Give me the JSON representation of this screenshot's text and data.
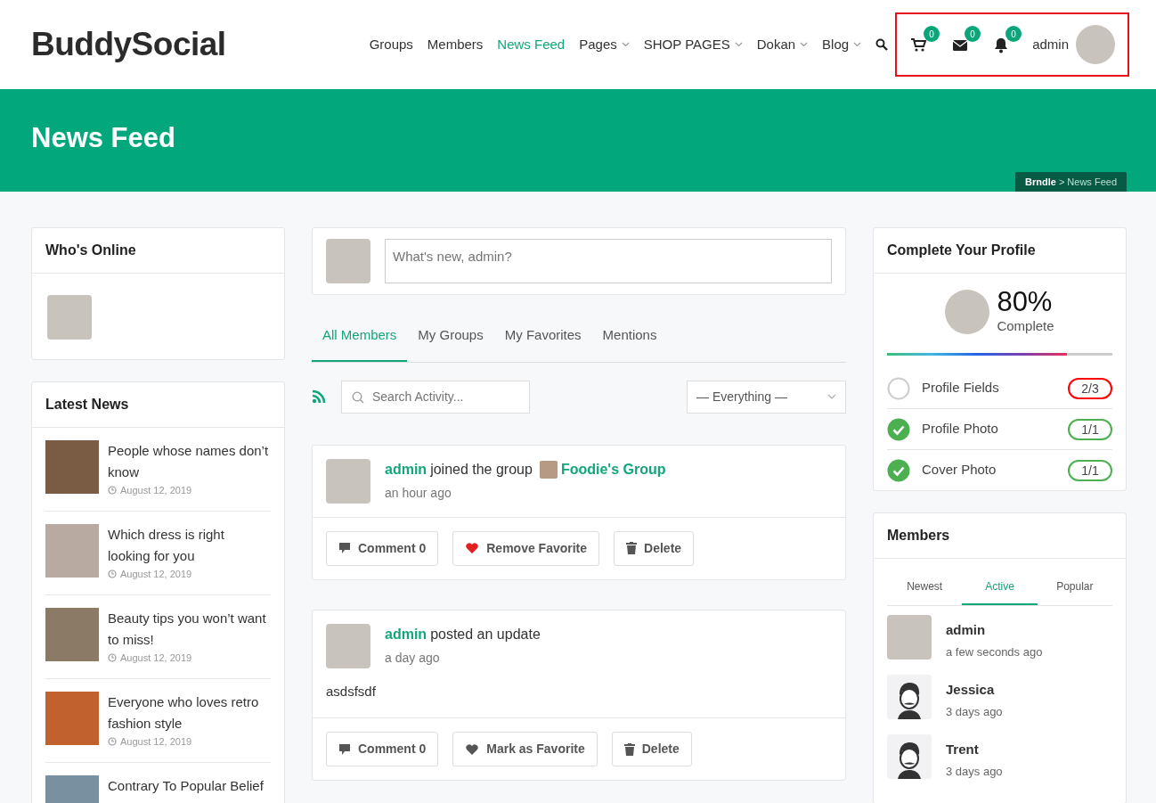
{
  "brand": "BuddySocial",
  "nav": [
    {
      "label": "Groups",
      "selected": false,
      "dropdown": false
    },
    {
      "label": "Members",
      "selected": false,
      "dropdown": false
    },
    {
      "label": "News Feed",
      "selected": true,
      "dropdown": false
    },
    {
      "label": "Pages",
      "selected": false,
      "dropdown": true
    },
    {
      "label": "SHOP PAGES",
      "selected": false,
      "dropdown": true
    },
    {
      "label": "Dokan",
      "selected": false,
      "dropdown": true
    },
    {
      "label": "Blog",
      "selected": false,
      "dropdown": true
    }
  ],
  "header_actions": {
    "highlighted": true,
    "counters": [
      {
        "kind": "cart",
        "count": "0"
      },
      {
        "kind": "messages",
        "count": "0"
      },
      {
        "kind": "notifications",
        "count": "0"
      }
    ],
    "user": "admin"
  },
  "page_title": "News Feed",
  "breadcrumb": "**Brndle** > News Feed",
  "whos_online": {
    "title": "Who's Online",
    "members": [
      {
        "kind": "photo"
      }
    ]
  },
  "latest_news": {
    "title": "Latest News",
    "items": [
      {
        "title": "People whose names don’t know",
        "date": "August 12, 2019"
      },
      {
        "title": "Which dress is right looking for you",
        "date": "August 12, 2019"
      },
      {
        "title": "Beauty tips you won’t want to miss!",
        "date": "August 12, 2019"
      },
      {
        "title": "Everyone who loves retro fashion style",
        "date": "August 12, 2019"
      },
      {
        "title": "Contrary To Popular Belief"
      }
    ]
  },
  "post_box": {
    "placeholder": "What's new, admin?"
  },
  "feed_tabs": [
    {
      "label": "All Members",
      "selected": true
    },
    {
      "label": "My Groups",
      "selected": false
    },
    {
      "label": "My Favorites",
      "selected": false
    },
    {
      "label": "Mentions",
      "selected": false
    }
  ],
  "search": {
    "placeholder": "Search Activity..."
  },
  "filter": {
    "value": "— Everything —"
  },
  "activities": [
    {
      "actor": "admin",
      "action": "joined the group",
      "group": "Foodie's Group",
      "time": "an hour ago",
      "buttons": [
        {
          "kind": "comment",
          "label": "Comment 0"
        },
        {
          "kind": "favorite",
          "label": "Remove Favorite",
          "favorited": true
        },
        {
          "kind": "delete",
          "label": "Delete"
        }
      ]
    },
    {
      "actor": "admin",
      "action": "posted an update",
      "time": "a day ago",
      "body": "asdsfsdf",
      "buttons": [
        {
          "kind": "comment",
          "label": "Comment 0"
        },
        {
          "kind": "favorite",
          "label": "Mark as Favorite",
          "favorited": false
        },
        {
          "kind": "delete",
          "label": "Delete"
        }
      ]
    }
  ],
  "profile_completion": {
    "title": "Complete Your Profile",
    "percent": "80%",
    "label": "Complete",
    "level": 0.8,
    "items": [
      {
        "label": "Profile Fields",
        "count": "2/3",
        "done": false
      },
      {
        "label": "Profile Photo",
        "count": "1/1",
        "done": true
      },
      {
        "label": "Cover Photo",
        "count": "1/1",
        "done": true
      }
    ]
  },
  "members_widget": {
    "title": "Members",
    "tabs": [
      {
        "label": "Newest",
        "selected": false
      },
      {
        "label": "Active",
        "selected": true
      },
      {
        "label": "Popular",
        "selected": false
      }
    ],
    "members": [
      {
        "name": "admin",
        "time": "a few seconds ago",
        "kind": "photo"
      },
      {
        "name": "Jessica",
        "time": "3 days ago",
        "kind": "silhouette"
      },
      {
        "name": "Trent",
        "time": "3 days ago",
        "kind": "silhouette"
      }
    ]
  }
}
